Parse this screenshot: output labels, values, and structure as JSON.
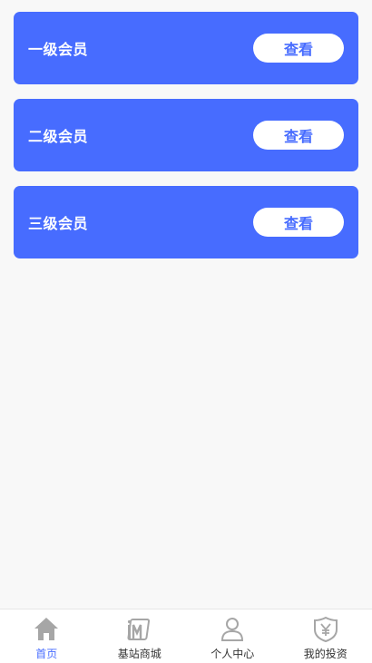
{
  "members": [
    {
      "title": "一级会员",
      "button": "查看"
    },
    {
      "title": "二级会员",
      "button": "查看"
    },
    {
      "title": "三级会员",
      "button": "查看"
    }
  ],
  "tabbar": {
    "items": [
      {
        "label": "首页",
        "icon": "home-icon",
        "active": true
      },
      {
        "label": "基站商城",
        "icon": "shop-icon",
        "active": false
      },
      {
        "label": "个人中心",
        "icon": "user-icon",
        "active": false
      },
      {
        "label": "我的投资",
        "icon": "investment-shield-icon",
        "active": false
      }
    ]
  },
  "colors": {
    "accent": "#476cff",
    "background": "#f8f8f8",
    "icon_gray": "#a6a6a6"
  }
}
